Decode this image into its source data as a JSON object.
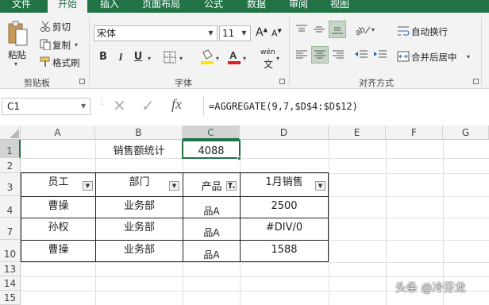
{
  "tabs": [
    "文件",
    "开始",
    "插入",
    "页面布局",
    "公式",
    "数据",
    "审阅",
    "视图"
  ],
  "clipboard": {
    "paste": "粘贴",
    "cut": "剪切",
    "copy": "复制",
    "copy_arrow": "▾",
    "format_painter": "格式刷",
    "group_label": "剪贴板"
  },
  "font": {
    "name": "宋体",
    "size": "11",
    "bold": "B",
    "italic": "I",
    "underline": "U",
    "grow": "A",
    "shrink": "A",
    "phonetic": "wén",
    "group_label": "字体"
  },
  "alignment": {
    "wrap_text": "自动换行",
    "merge_center": "合并后居中",
    "group_label": "对齐方式"
  },
  "colors": {
    "brand": "#217346",
    "font_color": "#e02020",
    "fill_color": "#ffe400"
  },
  "formula_bar": {
    "name_box": "C1",
    "formula": "=AGGREGATE(9,7,$D$4:$D$12)",
    "fx": "fx",
    "cancel": "✕",
    "enter": "✓"
  },
  "sheet": {
    "columns": [
      "A",
      "B",
      "C",
      "D",
      "E",
      "F",
      "G"
    ],
    "rows": [
      "1",
      "2",
      "3",
      "4",
      "7",
      "10",
      "13",
      "14",
      "15"
    ],
    "title_label": "销售额统计",
    "result": "4088",
    "headers": [
      "员工",
      "部门",
      "产品",
      "1月销售"
    ],
    "data": [
      [
        "曹操",
        "业务部",
        "品A",
        "2500"
      ],
      [
        "孙权",
        "业务部",
        "品A",
        "#DIV/0"
      ],
      [
        "曹操",
        "业务部",
        "品A",
        "1588"
      ]
    ]
  },
  "watermark": "头条 @冷芬龙"
}
